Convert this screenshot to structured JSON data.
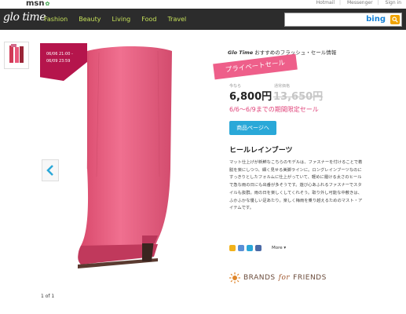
{
  "topbar": {
    "logo": "msn",
    "links": [
      "Hotmail",
      "Messenger",
      "Sign in"
    ]
  },
  "header": {
    "logo": "glo time",
    "nav": [
      "Fashion",
      "Beauty",
      "Living",
      "Food",
      "Travel"
    ],
    "search": {
      "brand": "bing",
      "placeholder": ""
    }
  },
  "photo": {
    "ribbon_line1": "06/06 21:00 -",
    "ribbon_line2": "06/09 23:59"
  },
  "gallery": {
    "counter": "1 of 1"
  },
  "product": {
    "title_brand": "Glo Time",
    "title_rest": "おすすめのフラッシュ・セール情報",
    "banner": "プライベートセール",
    "price_label": "今なら",
    "orig_label": "通常価格",
    "price": "6,800円",
    "orig_price": "13,650円",
    "limited": "6/6〜6/9までの期間限定セール",
    "button": "商品ページへ",
    "name": "ヒールレインブーツ",
    "description": "マット仕上げが新鮮なこちらのモデルは、ファスナーを付けることで着脱を楽にしつつ、細く見せる美脚ラインに。ロングレインブーツなのにすっきりとしたフォルムに仕上がっていて、軽めに履ける太さのヒールで急な雨の日にも出番が多そうです。遊び心あふれるファスナーでスタイルも抜群。雨の日を楽しくしてくれそう。取り外し可能な中敷きは、ふかふかな優しい足あたり。楽しく梅雨を乗り越えるためのマスト・アイテムです。",
    "more": "More ▾",
    "brand_a": "BRANDS",
    "brand_b": "for",
    "brand_c": "FRIENDS"
  },
  "colors": {
    "accent_pink": "#e0457b",
    "banner_pink": "#ee5f8a",
    "nav_green": "#c6e15a",
    "button_blue": "#2aa8d8",
    "boot": "#e9577a"
  }
}
